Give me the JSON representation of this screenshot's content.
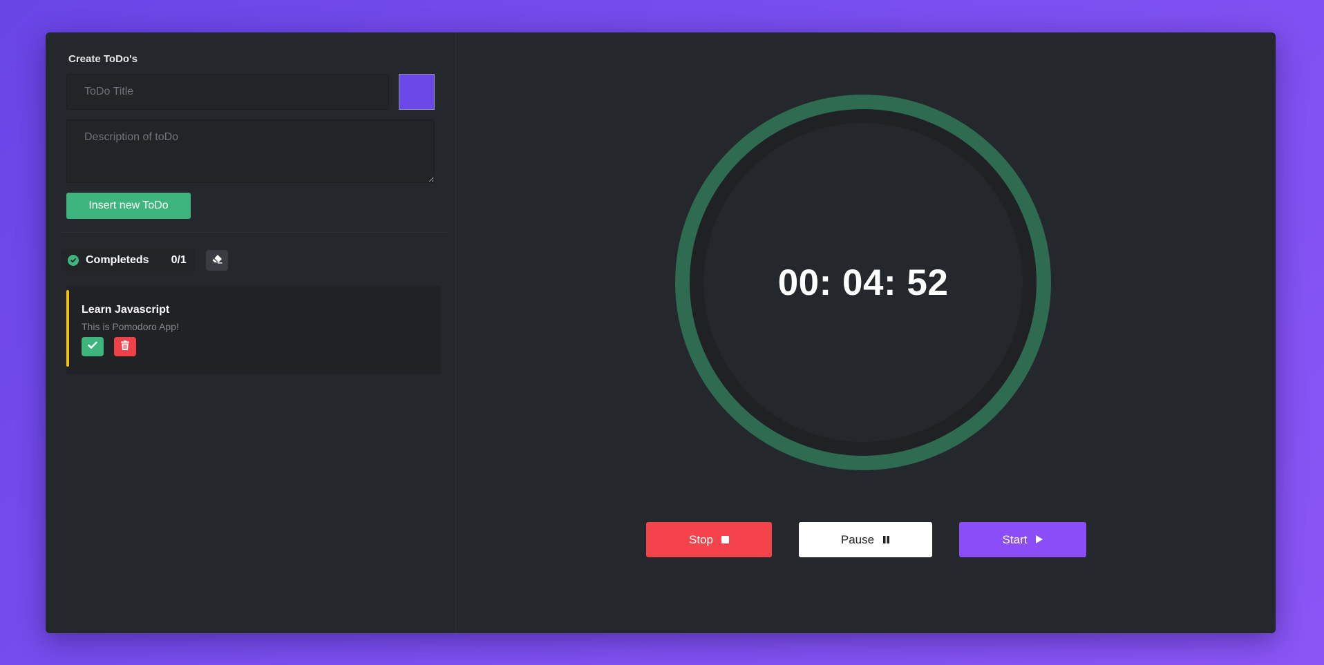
{
  "todo_form": {
    "heading": "Create ToDo's",
    "title_placeholder": "ToDo Title",
    "title_value": "",
    "description_placeholder": "Description of toDo",
    "description_value": "",
    "selected_color": "#6a49e8",
    "insert_button": "Insert new ToDo"
  },
  "completed": {
    "label": "Completeds",
    "count": "0/1"
  },
  "todos": [
    {
      "title": "Learn Javascript",
      "description": "This is Pomodoro App!",
      "accent_color": "#f5c20f"
    }
  ],
  "timer": {
    "display": "00: 04: 52",
    "ring_color": "#2f6b51",
    "track_color": "#1f2124"
  },
  "controls": {
    "stop": "Stop",
    "pause": "Pause",
    "start": "Start"
  },
  "colors": {
    "background": "#7b4ff0",
    "panel": "#24272b",
    "green": "#3eb57c",
    "red": "#f5434b",
    "purple": "#8a4df7"
  },
  "icons": {
    "completed": "check-circle-icon",
    "clear": "eraser-icon",
    "done": "check-icon",
    "delete": "trash-icon",
    "stop": "stop-icon",
    "pause": "pause-icon",
    "start": "play-icon"
  }
}
